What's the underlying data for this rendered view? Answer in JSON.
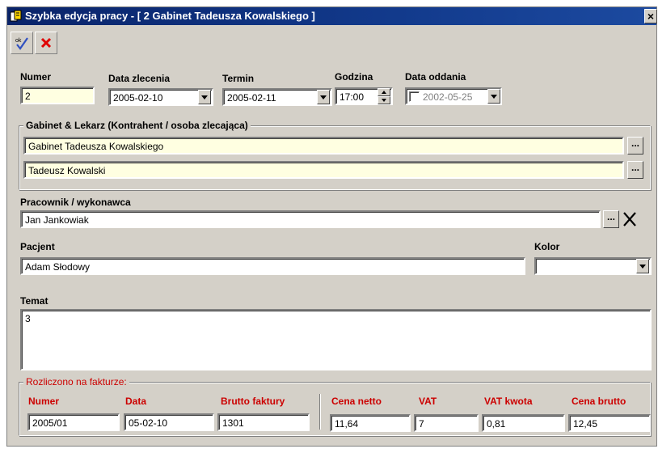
{
  "window": {
    "title": "Szybka edycja pracy -  [ 2 Gabinet Tadeusza Kowalskiego ]",
    "close_label": "×"
  },
  "toolbar": {
    "ok_icon": "ok-check-icon",
    "cancel_icon": "red-x-icon"
  },
  "order": {
    "number_label": "Numer",
    "number_value": "2",
    "order_date_label": "Data zlecenia",
    "order_date_value": "2005-02-10",
    "deadline_label": "Termin",
    "deadline_value": "2005-02-11",
    "hour_label": "Godzina",
    "hour_value": "17:00",
    "return_date_label": "Data oddania",
    "return_date_value": "2002-05-25"
  },
  "clinic": {
    "group_title": "Gabinet & Lekarz (Kontrahent / osoba zlecająca)",
    "clinic_value": "Gabinet Tadeusza Kowalskiego",
    "doctor_value": "Tadeusz Kowalski",
    "ellipsis_label": "..."
  },
  "worker": {
    "label": "Pracownik / wykonawca",
    "value": "Jan Jankowiak",
    "ellipsis_label": "..."
  },
  "patient": {
    "label": "Pacjent",
    "value": "Adam Słodowy",
    "color_label": "Kolor",
    "color_value": ""
  },
  "topic": {
    "label": "Temat",
    "value": "3"
  },
  "invoice": {
    "group_title": "Rozliczono na fakturze:",
    "number_label": "Numer",
    "number_value": "2005/01",
    "date_label": "Data",
    "date_value": "05-02-10",
    "gross_invoice_label": "Brutto faktury",
    "gross_invoice_value": "1301",
    "net_price_label": "Cena netto",
    "net_price_value": "11,64",
    "vat_label": "VAT",
    "vat_value": "7",
    "vat_amount_label": "VAT kwota",
    "vat_amount_value": "0,81",
    "gross_price_label": "Cena brutto",
    "gross_price_value": "12,45"
  },
  "colors": {
    "title_bar": "#0a246a",
    "window_bg": "#d4d0c8",
    "highlight_field": "#ffffe1",
    "invoice_label": "#cc0000"
  }
}
